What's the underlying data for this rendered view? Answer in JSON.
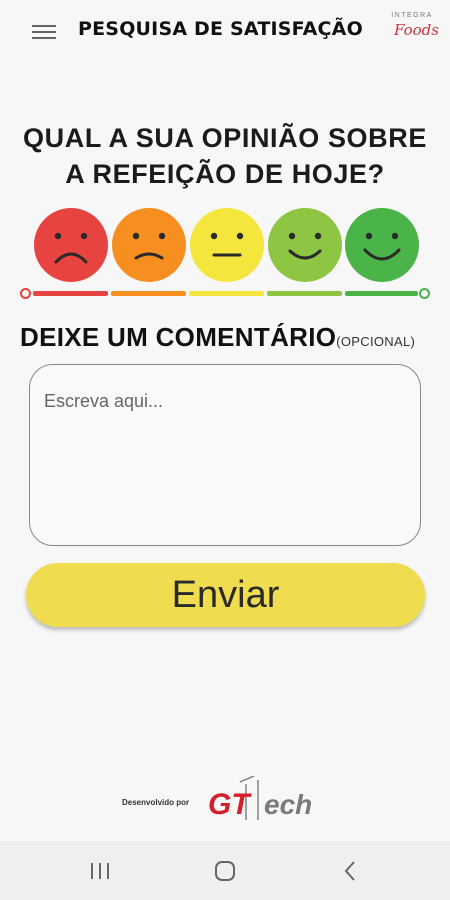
{
  "app_bar": {
    "title": "PESQUISA DE SATISFAÇÃO",
    "brand_top": "INTEGRA",
    "brand_script": "Foods"
  },
  "survey": {
    "question_line1": "QUAL A SUA OPINIÃO SOBRE",
    "question_line2": "A REFEIÇÃO DE HOJE?",
    "faces": [
      {
        "mood": "very-unhappy",
        "color": "#e74341"
      },
      {
        "mood": "unhappy",
        "color": "#f68f1f"
      },
      {
        "mood": "neutral",
        "color": "#f5e63e"
      },
      {
        "mood": "happy",
        "color": "#8ec543"
      },
      {
        "mood": "very-happy",
        "color": "#4bb449"
      }
    ]
  },
  "comment": {
    "title": "DEIXE UM COMENTÁRIO",
    "optional": "(OPCIONAL)",
    "placeholder": "Escreva aqui..."
  },
  "submit": {
    "label": "Enviar"
  },
  "footer": {
    "developed_by": "Desenvolvido por",
    "logo_gt": "GT",
    "logo_tech": "ech"
  },
  "nav": {
    "recents": "recents-icon",
    "home": "home-icon",
    "back": "back-icon"
  }
}
